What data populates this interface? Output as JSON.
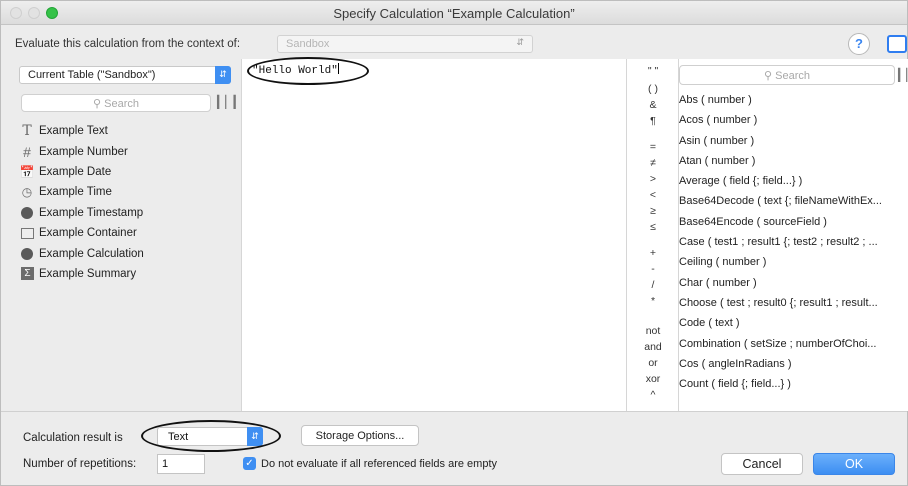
{
  "window": {
    "title": "Specify Calculation “Example Calculation”"
  },
  "context": {
    "label": "Evaluate this calculation from the context of:",
    "value": "Sandbox",
    "help": "?"
  },
  "left": {
    "table_select": "Current Table (\"Sandbox\")",
    "search_placeholder": "Search",
    "fields": [
      {
        "label": "Example Text",
        "icon": "text-field-icon"
      },
      {
        "label": "Example Number",
        "icon": "number-field-icon"
      },
      {
        "label": "Example Date",
        "icon": "date-field-icon"
      },
      {
        "label": "Example Time",
        "icon": "time-field-icon"
      },
      {
        "label": "Example Timestamp",
        "icon": "timestamp-field-icon"
      },
      {
        "label": "Example Container",
        "icon": "container-field-icon"
      },
      {
        "label": "Example Calculation",
        "icon": "calculation-field-icon"
      },
      {
        "label": "Example Summary",
        "icon": "summary-field-icon"
      }
    ]
  },
  "formula": {
    "text": "\"Hello World\""
  },
  "operators": [
    "\" \"",
    "( )",
    "&",
    "¶",
    "=",
    "≠",
    ">",
    "<",
    "≥",
    "≤",
    "+",
    "-",
    "/",
    "*",
    "not",
    "and",
    "or",
    "xor",
    "^"
  ],
  "functions": {
    "search_placeholder": "Search",
    "items": [
      "Abs ( number )",
      "Acos ( number )",
      "Asin ( number )",
      "Atan ( number )",
      "Average ( field {; field...} )",
      "Base64Decode ( text {; fileNameWithEx...",
      "Base64Encode ( sourceField )",
      "Case ( test1 ; result1 {; test2 ; result2 ; ...",
      "Ceiling ( number )",
      "Char ( number )",
      "Choose ( test ; result0 {; result1 ; result...",
      "Code ( text )",
      "Combination ( setSize ; numberOfChoi...",
      "Cos ( angleInRadians )",
      "Count ( field {; field...} )"
    ]
  },
  "bottom": {
    "result_label": "Calculation result is",
    "result_value": "Text",
    "storage_button": "Storage Options...",
    "repetitions_label": "Number of repetitions:",
    "repetitions_value": "1",
    "checkbox_label": "Do not evaluate if all referenced fields are empty",
    "checkbox_checked": true,
    "cancel": "Cancel",
    "ok": "OK"
  }
}
